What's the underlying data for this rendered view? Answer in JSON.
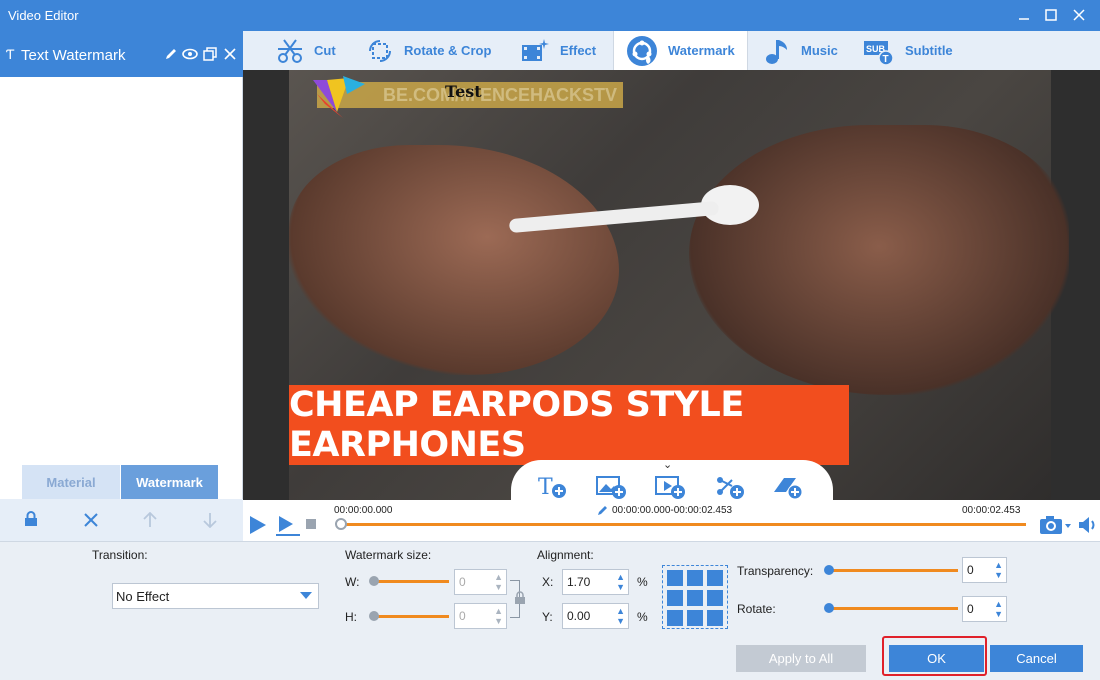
{
  "window": {
    "title": "Video Editor"
  },
  "sidebar": {
    "header_label": "Text Watermark",
    "tabs": [
      {
        "label": "Material"
      },
      {
        "label": "Watermark"
      }
    ]
  },
  "toolbar": {
    "tools": [
      {
        "label": "Cut",
        "icon": "scissors-icon"
      },
      {
        "label": "Rotate & Crop",
        "icon": "rotate-crop-icon"
      },
      {
        "label": "Effect",
        "icon": "effect-icon"
      },
      {
        "label": "Watermark",
        "icon": "watermark-icon",
        "active": true
      },
      {
        "label": "Music",
        "icon": "music-note-icon"
      },
      {
        "label": "Subtitle",
        "icon": "subtitle-icon"
      }
    ]
  },
  "preview": {
    "watermark_text": "Test",
    "overlay_text": "BE.COM/M    ENCEHACKSTV",
    "caption": "CHEAP EARPODS STYLE EARPHONES"
  },
  "timeline": {
    "start_time": "00:00:00.000",
    "range_time": "00:00:00.000-00:00:02.453",
    "end_time": "00:00:02.453"
  },
  "settings": {
    "transition_label": "Transition:",
    "transition_value": "No Effect",
    "size_label": "Watermark size:",
    "w_label": "W:",
    "w_value": "0",
    "h_label": "H:",
    "h_value": "0",
    "alignment_label": "Alignment:",
    "x_label": "X:",
    "x_value": "1.70",
    "y_label": "Y:",
    "y_value": "0.00",
    "percent": "%",
    "transparency_label": "Transparency:",
    "transparency_value": "0",
    "rotate_label": "Rotate:",
    "rotate_value": "0"
  },
  "buttons": {
    "apply_all": "Apply to All",
    "ok": "OK",
    "cancel": "Cancel"
  },
  "colors": {
    "accent": "#3d85d8",
    "slider": "#f08a1f",
    "highlight": "#e0202a",
    "caption_bg": "#f24e1e"
  }
}
